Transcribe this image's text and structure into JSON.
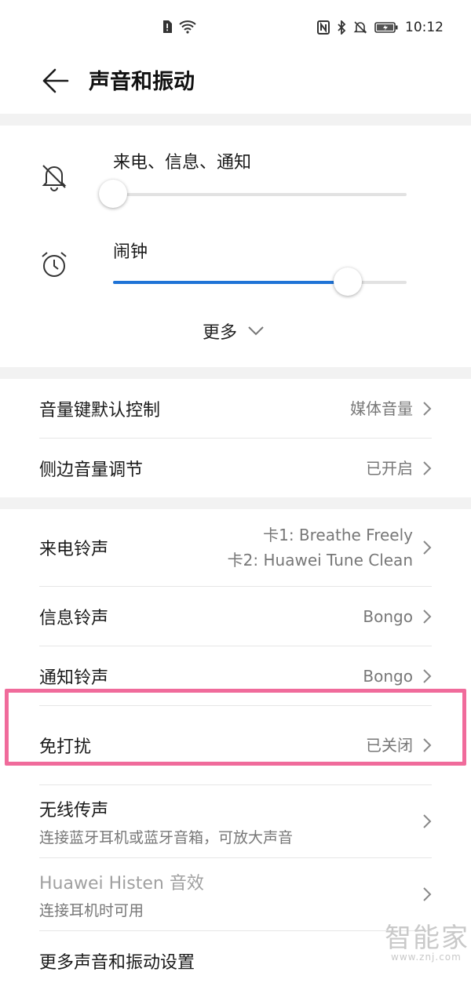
{
  "status_bar": {
    "time": "10:12",
    "icons_left": [
      "sim-alert-icon",
      "wifi-icon"
    ],
    "icons_right": [
      "nfc-icon",
      "bluetooth-icon",
      "mute-icon",
      "battery-icon"
    ]
  },
  "header": {
    "title": "声音和振动"
  },
  "volume": {
    "ringtone_label": "来电、信息、通知",
    "ringtone_level": 0,
    "alarm_label": "闹钟",
    "alarm_level": 0.8,
    "more_label": "更多"
  },
  "settings": {
    "volume_key_default": {
      "label": "音量键默认控制",
      "value": "媒体音量"
    },
    "side_volume": {
      "label": "侧边音量调节",
      "value": "已开启"
    },
    "call_ringtone": {
      "label": "来电铃声",
      "value_line1": "卡1: Breathe Freely",
      "value_line2": "卡2: Huawei Tune Clean"
    },
    "message_ringtone": {
      "label": "信息铃声",
      "value": "Bongo"
    },
    "notification_ringtone": {
      "label": "通知铃声",
      "value": "Bongo"
    },
    "do_not_disturb": {
      "label": "免打扰",
      "value": "已关闭"
    },
    "wireless_audio": {
      "label": "无线传声",
      "sub": "连接蓝牙耳机或蓝牙音箱，可放大声音"
    },
    "histen": {
      "label": "Huawei Histen 音效",
      "sub": "连接耳机时可用"
    },
    "more_settings": {
      "label": "更多声音和振动设置"
    }
  },
  "watermark": {
    "text": "智能家",
    "url": "www.znj.com"
  },
  "colors": {
    "accent": "#1f73d6",
    "highlight": "#f06b9b"
  }
}
